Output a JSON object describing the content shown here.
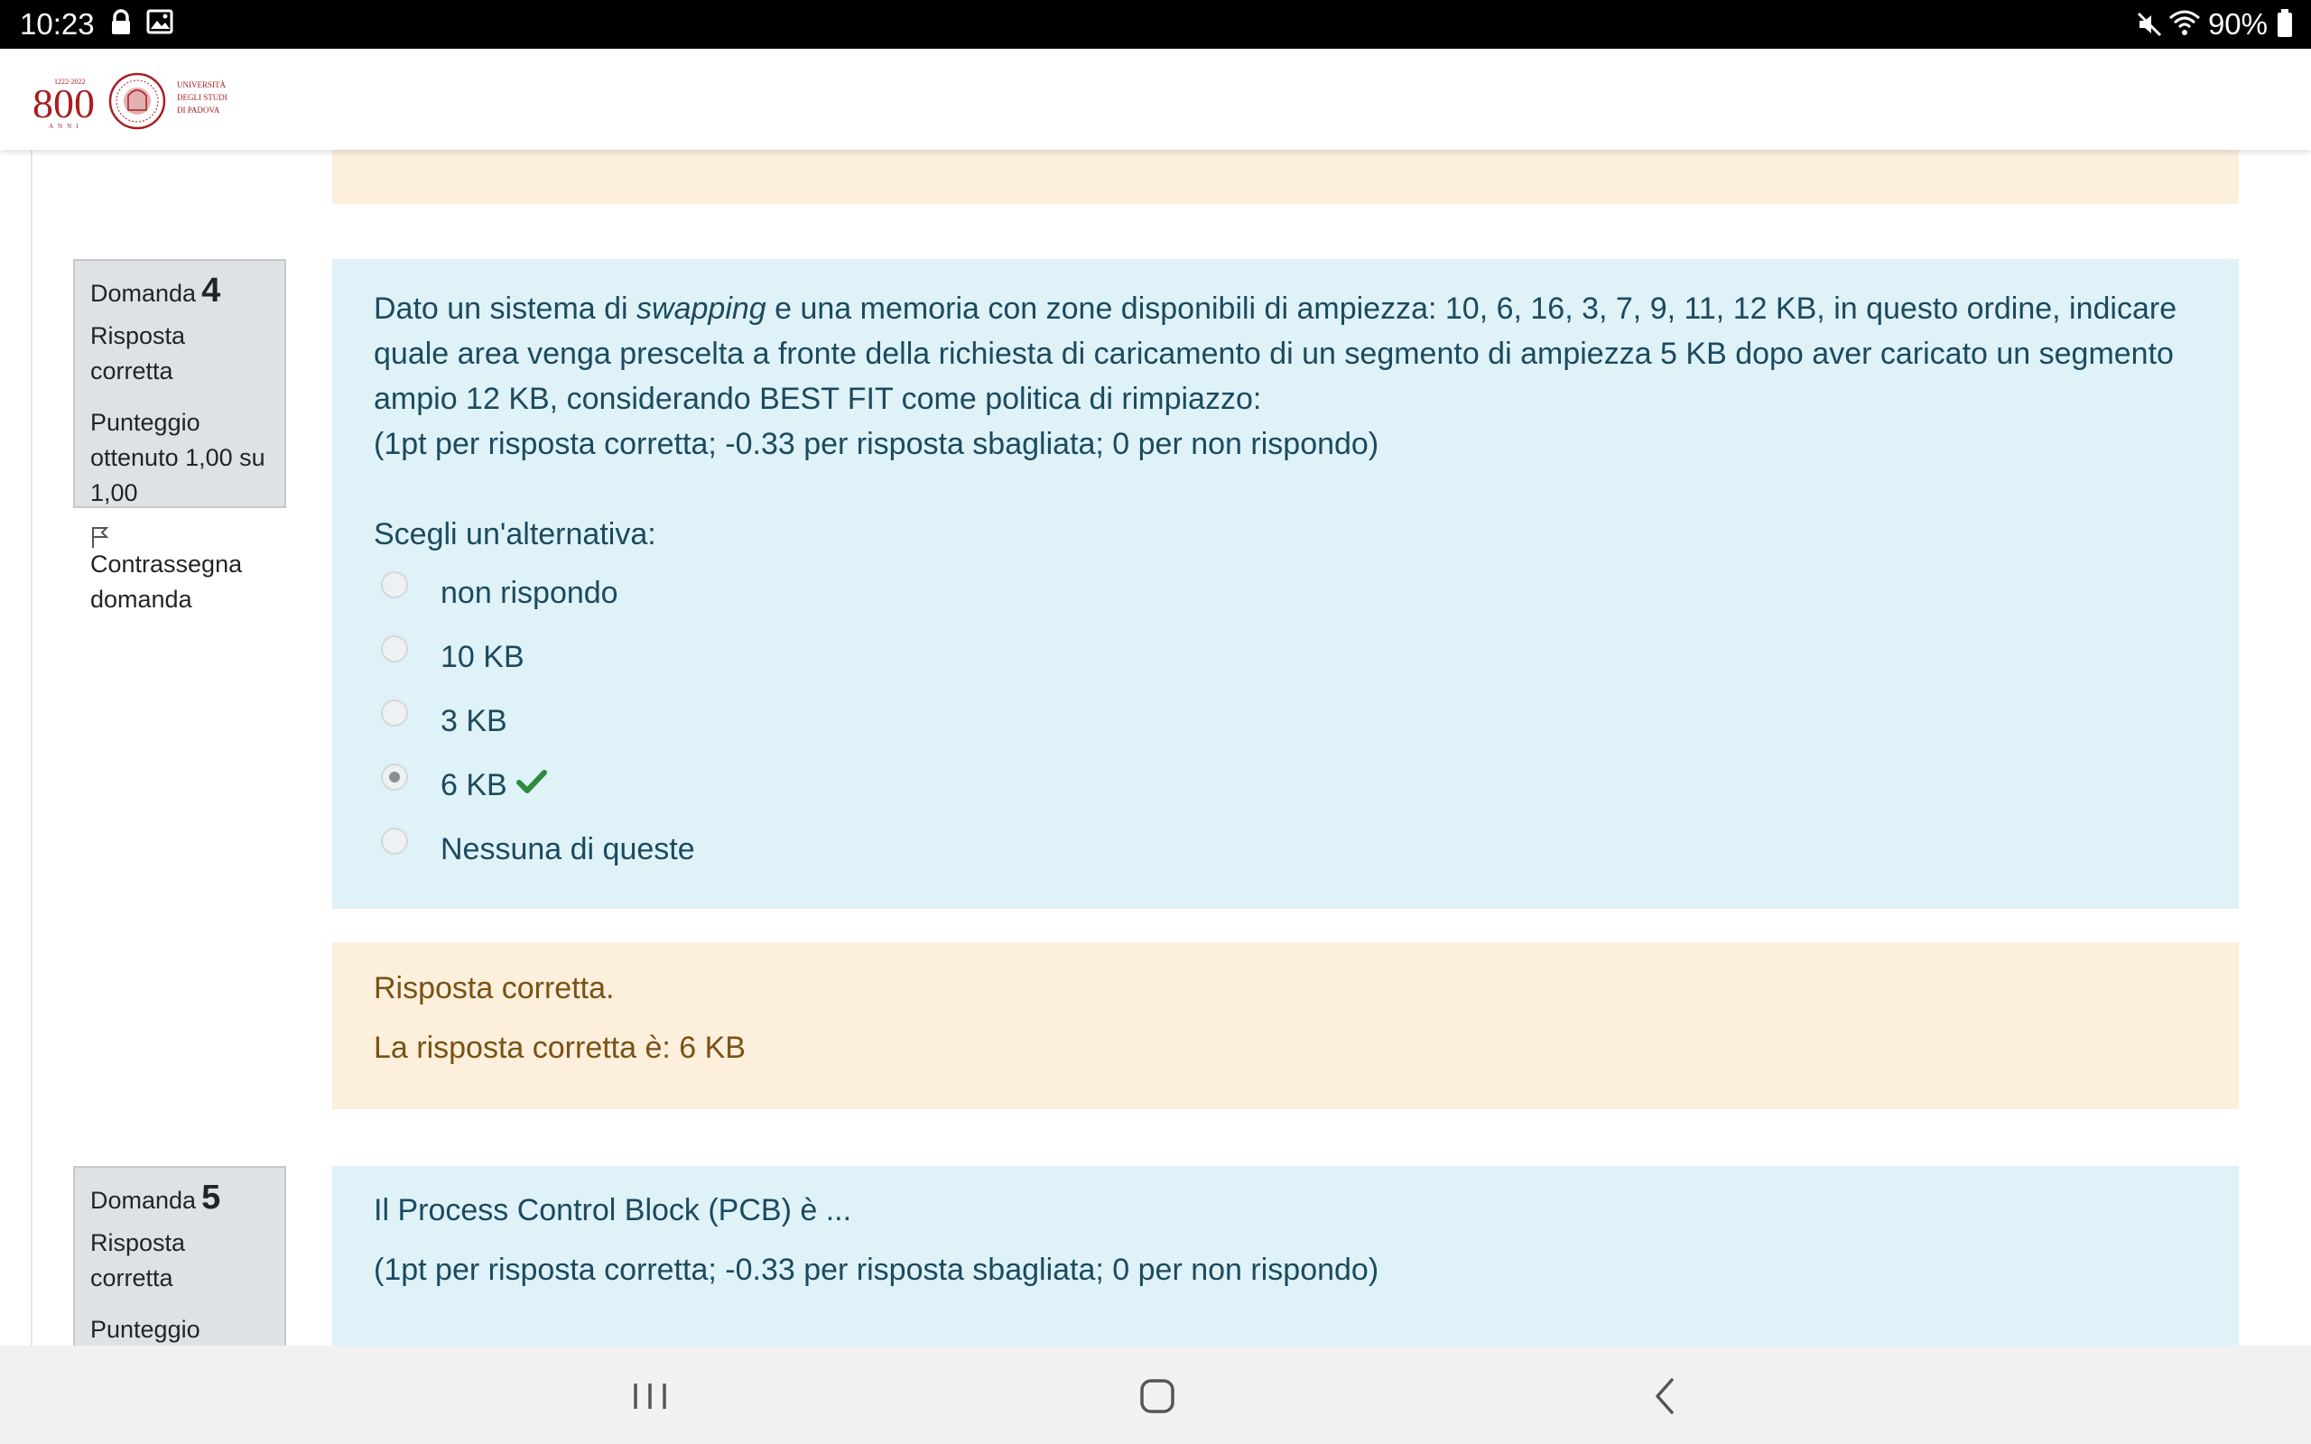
{
  "status_bar": {
    "time": "10:23",
    "left_icons": [
      "lock-icon",
      "image-icon"
    ],
    "right_icons": [
      "mute-icon",
      "wifi-icon",
      "battery-icon"
    ],
    "battery": "90%"
  },
  "header": {
    "logo_icon": "university-of-padova-logo",
    "logo_numeral": "800",
    "logo_years": "1222-2022",
    "logo_anni": "ANNI",
    "logo_name_lines": [
      "UNIVERSITÀ",
      "DEGLI STUDI",
      "DI PADOVA"
    ]
  },
  "questions": [
    {
      "info": {
        "label": "Domanda",
        "number": "4",
        "status": "Risposta corretta",
        "score": "Punteggio ottenuto 1,00 su 1,00",
        "flag_label": "Contrassegna domanda"
      },
      "text_before_em": "Dato un sistema di ",
      "text_em": "swapping",
      "text_after_em": " e una memoria con zone disponibili di ampiezza: 10, 6, 16, 3, 7, 9, 11, 12 KB, in questo ordine, indicare quale area venga prescelta a fronte della richiesta di caricamento di un segmento di ampiezza 5 KB dopo aver caricato un segmento ampio 12 KB, considerando BEST FIT come politica di rimpiazzo:",
      "scoring": "(1pt per risposta corretta; -0.33 per risposta sbagliata; 0 per non rispondo)",
      "prompt": "Scegli un'alternativa:",
      "options": [
        {
          "label": "non rispondo",
          "selected": false
        },
        {
          "label": "10 KB",
          "selected": false
        },
        {
          "label": "3 KB",
          "selected": false
        },
        {
          "label": "6 KB",
          "selected": true,
          "marker": "check-icon"
        },
        {
          "label": "Nessuna di queste",
          "selected": false
        }
      ],
      "feedback": {
        "result": "Risposta corretta.",
        "correct_answer": "La risposta corretta è: 6 KB"
      }
    },
    {
      "info": {
        "label": "Domanda",
        "number": "5",
        "status": "Risposta corretta",
        "score_partial": "Punteggio"
      },
      "text": "Il Process Control Block (PCB) è ...",
      "scoring": "(1pt per risposta corretta; -0.33 per risposta sbagliata; 0 per non rispondo)"
    }
  ],
  "nav_bar": {
    "buttons": [
      "recent-apps-icon",
      "home-icon",
      "back-icon"
    ]
  },
  "colors": {
    "question_bg": "#def2f8",
    "feedback_bg": "#fcefdc",
    "info_bg": "#dee2e6",
    "correct_check": "#2e8b3d",
    "logo_red": "#a81f23"
  }
}
